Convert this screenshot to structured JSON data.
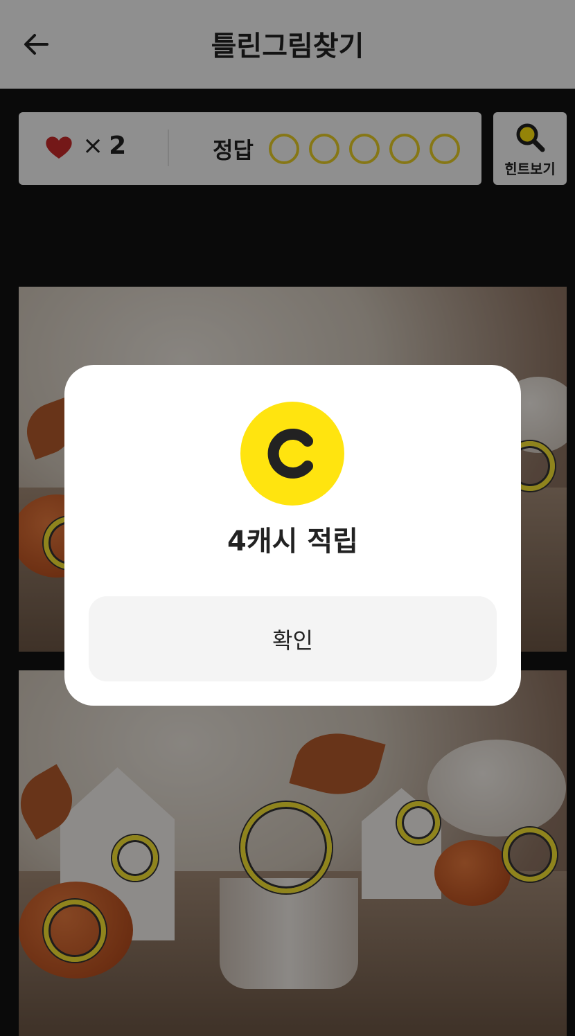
{
  "header": {
    "title": "틀린그림찾기",
    "back_icon": "back-arrow-icon"
  },
  "status": {
    "lives_icon": "heart-icon",
    "lives_prefix": "×",
    "lives_count": "2",
    "answer_label": "정답",
    "answers_total": 5,
    "answers_found": 0
  },
  "hint": {
    "icon": "magnifier-icon",
    "label": "힌트보기"
  },
  "dialog": {
    "coin_icon": "cash-coin-icon",
    "reward_text": "4캐시 적립",
    "confirm_label": "확인"
  },
  "colors": {
    "accent_yellow": "#ffe40f",
    "ring_yellow": "#f7e432",
    "heart_red": "#c92a2a"
  }
}
